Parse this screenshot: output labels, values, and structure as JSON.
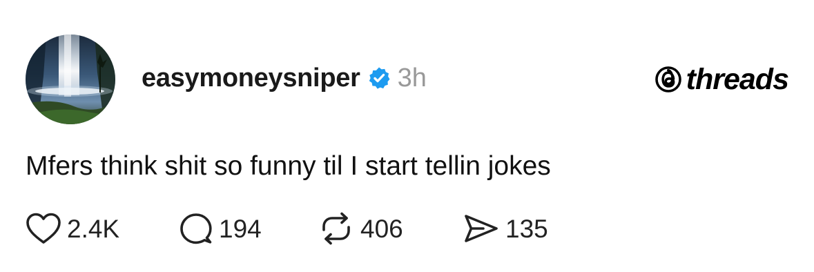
{
  "post": {
    "username": "easymoneysniper",
    "verified": true,
    "time": "3h",
    "text": "Mfers think shit so funny til I start tellin jokes"
  },
  "brand": {
    "name": "threads",
    "icon": "threads-logo-icon"
  },
  "actions": {
    "likes": "2.4K",
    "comments": "194",
    "reposts": "406",
    "shares": "135"
  },
  "icons": {
    "like": "heart-icon",
    "comment": "comment-bubble-icon",
    "repost": "repost-icon",
    "share": "send-icon",
    "verified": "verified-badge-icon"
  },
  "colors": {
    "verified": "#1d9bf0",
    "timestamp": "#999999",
    "text": "#111111"
  }
}
